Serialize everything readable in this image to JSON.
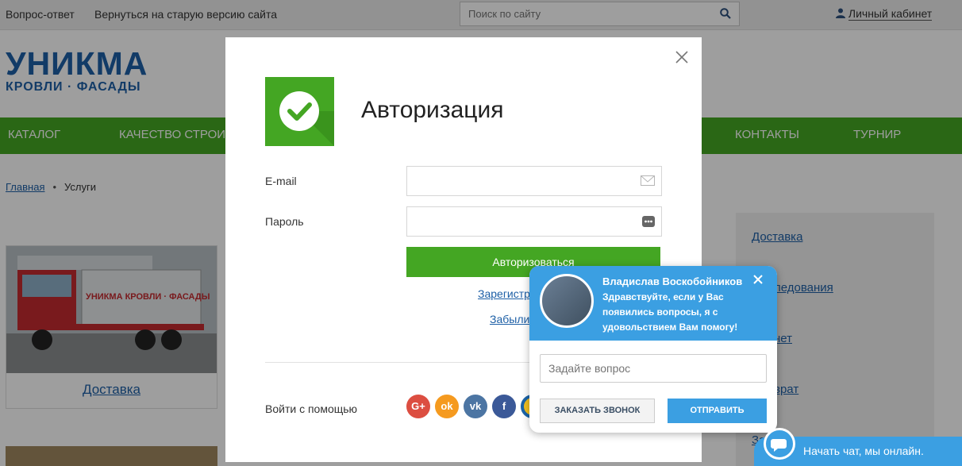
{
  "topbar": {
    "faq": "Вопрос-ответ",
    "old_site": "Вернуться на старую версию сайта",
    "search_placeholder": "Поиск по сайту",
    "cabinet": "Личный кабинет"
  },
  "logo": {
    "line1": "УНИКМА",
    "line2": "КРОВЛИ · ФАСАДЫ"
  },
  "nav": {
    "items": [
      "КАТАЛОГ",
      "КАЧЕСТВО СТРОИТ",
      "КОНТАКТЫ",
      "ТУРНИР"
    ]
  },
  "breadcrumb": {
    "home": "Главная",
    "current": "Услуги"
  },
  "card": {
    "truck_text": "УНИКМА КРОВЛИ · ФАСАДЫ",
    "label": "Доставка"
  },
  "sidebar": {
    "items": [
      "Доставка",
      "ледования",
      "нет",
      "врат",
      "За"
    ]
  },
  "modal": {
    "title": "Авторизация",
    "email_label": "E-mail",
    "password_label": "Пароль",
    "login_button": "Авторизоваться",
    "register_link": "Зарегистр",
    "forgot_link": "Забыли",
    "social_label": "Войти с помощью",
    "social": [
      "G+",
      "ok",
      "vk",
      "f"
    ]
  },
  "chat": {
    "operator_name": "Владислав Воскобойников",
    "greeting": "Здравствуйте, если у Вас появились вопросы, я с удовольствием Вам помогу!",
    "ask_placeholder": "Задайте вопрос",
    "call_button": "ЗАКАЗАТЬ ЗВОНОК",
    "send_button": "ОТПРАВИТЬ",
    "bar_text": "Начать чат, мы онлайн."
  },
  "colors": {
    "green": "#44a623",
    "blue": "#1d5fa6",
    "chat_blue": "#3b9fe2"
  }
}
